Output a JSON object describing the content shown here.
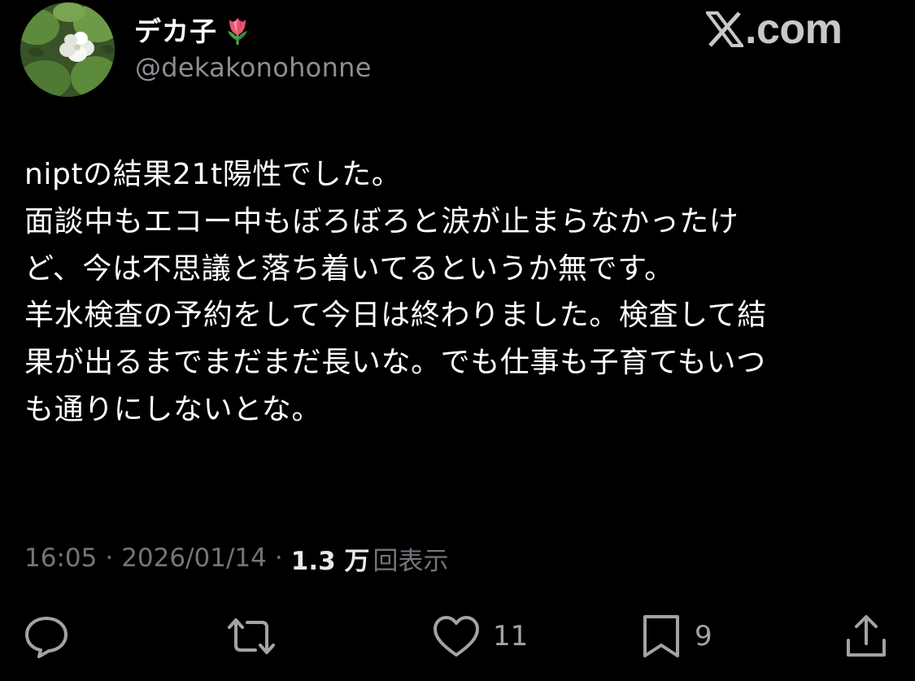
{
  "author": {
    "display_name": "デカ子",
    "display_name_emoji": "tulip-icon",
    "handle": "@dekakonohonne",
    "avatar": "flower-avatar"
  },
  "watermark": {
    "text": ".com",
    "logo": "x-logo-icon"
  },
  "post": {
    "lines": [
      "niptの結果21t陽性でした。",
      "面談中もエコー中もぼろぼろと涙が止まらなかったけ",
      "ど、今は不思議と落ち着いてるというか無です。",
      "羊水検査の予約をして今日は終わりました。検査して結",
      "果が出るまでまだまだ長いな。でも仕事も子育てもいつ",
      "も通りにしないとな。"
    ]
  },
  "meta": {
    "time": "16:05",
    "separator": "·",
    "date": "2026/01/14",
    "views_count": "1.3 万",
    "views_label": "回表示"
  },
  "actions": {
    "reply": {
      "icon": "reply-icon",
      "count": ""
    },
    "repost": {
      "icon": "repost-icon",
      "count": ""
    },
    "like": {
      "icon": "heart-icon",
      "count": "11"
    },
    "bookmark": {
      "icon": "bookmark-icon",
      "count": "9"
    },
    "share": {
      "icon": "share-icon",
      "count": ""
    }
  },
  "colors": {
    "background": "#000000",
    "text_primary": "#ffffff",
    "text_secondary": "#71767b",
    "icon": "#a0a4a8"
  }
}
